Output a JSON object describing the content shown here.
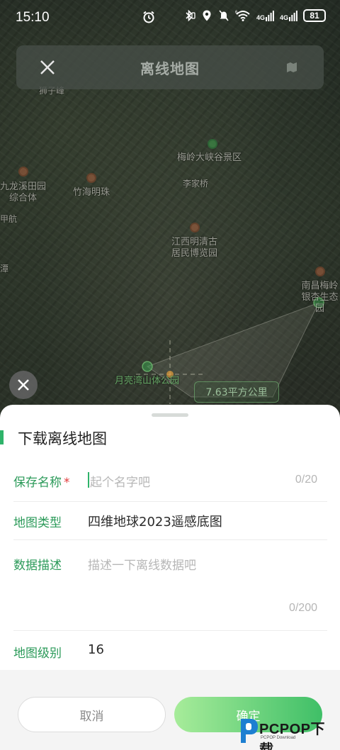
{
  "status_bar": {
    "time": "15:10",
    "network_1": "4G",
    "network_2": "4G",
    "wifi_badge": "6",
    "battery": "81"
  },
  "header": {
    "title": "离线地图"
  },
  "map": {
    "labels": {
      "poi_top_left": "狮子峰",
      "jiulong": "九龙溪田园\n综合体",
      "zhuhai": "竹海明珠",
      "meiling": "梅岭大峡谷景区",
      "lijia": "李家桥",
      "jiangxi": "江西明清古\n居民博览园",
      "nanchang": "南昌梅岭\n银杏生态园",
      "yuelianghu": "月亮湾山体公园",
      "jiahang": "甲航",
      "tan": "潭"
    },
    "area_badge": "7.63平方公里"
  },
  "sheet": {
    "title": "下载离线地图",
    "save_name": {
      "label": "保存名称",
      "required_mark": "*",
      "placeholder": "起个名字吧",
      "counter": "0/20"
    },
    "map_type": {
      "label": "地图类型",
      "value": "四维地球2023遥感底图"
    },
    "description": {
      "label": "数据描述",
      "placeholder": "描述一下离线数据吧",
      "counter": "0/200"
    },
    "map_level": {
      "label": "地图级别",
      "value": "16"
    }
  },
  "actions": {
    "cancel_label": "取消",
    "confirm_label": "确定"
  },
  "watermark": {
    "text": "PCPOP下载",
    "sub": "PCPOP Download"
  },
  "colors": {
    "accent": "#2fb36a",
    "label_green": "#2b9a59",
    "required_red": "#e03a3a",
    "confirm_gradient_start": "#a7ec9a",
    "confirm_gradient_end": "#3fbf67"
  }
}
